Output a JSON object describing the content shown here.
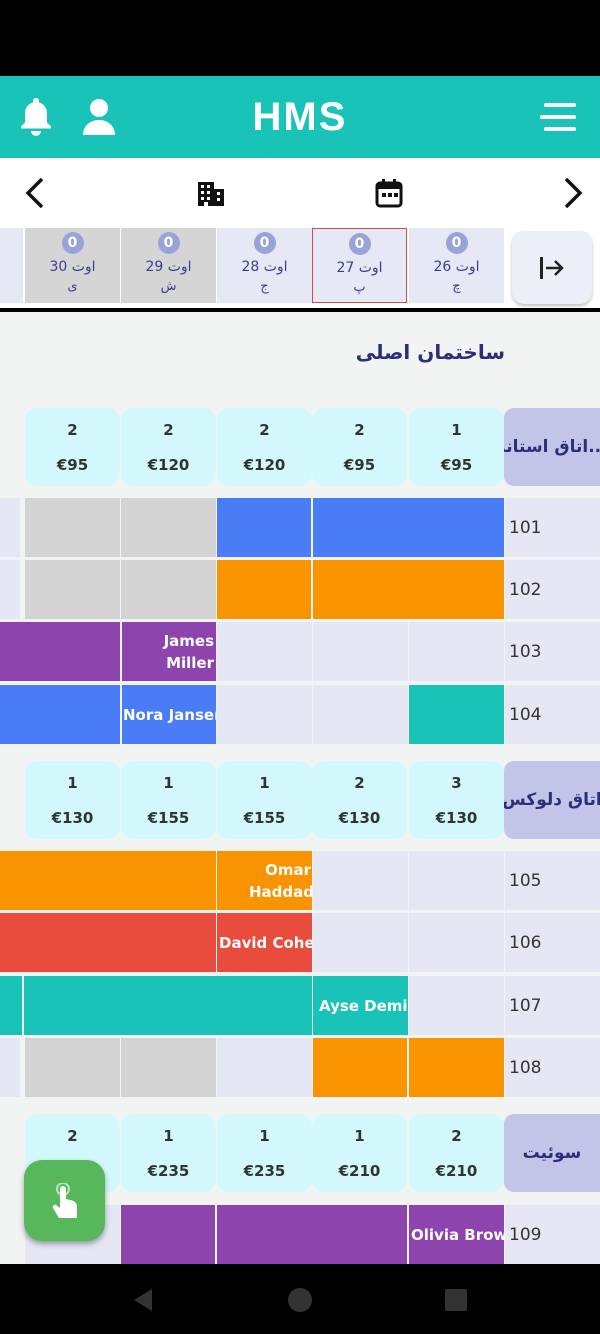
{
  "app": {
    "title": "HMS"
  },
  "nav": {
    "prev": "chevron-left-icon",
    "next": "chevron-right-icon",
    "building_icon": "building-icon",
    "calendar_icon": "calendar-icon"
  },
  "dates": [
    {
      "count": "0",
      "date": "26 اوت",
      "day": "چ"
    },
    {
      "count": "0",
      "date": "27 اوت",
      "day": "پ"
    },
    {
      "count": "0",
      "date": "28 اوت",
      "day": "ج"
    },
    {
      "count": "0",
      "date": "29 اوت",
      "day": "ش"
    },
    {
      "count": "0",
      "date": "30 اوت",
      "day": "ی"
    }
  ],
  "building": {
    "name": "ساختمان اصلی"
  },
  "room_types": [
    {
      "label": "اتاق استاند...",
      "cells": [
        {
          "count": "1",
          "price": "€95"
        },
        {
          "count": "2",
          "price": "€95"
        },
        {
          "count": "2",
          "price": "€120"
        },
        {
          "count": "2",
          "price": "€120"
        },
        {
          "count": "2",
          "price": "€95"
        }
      ]
    },
    {
      "label": "اتاق دلوکس",
      "cells": [
        {
          "count": "3",
          "price": "€130"
        },
        {
          "count": "2",
          "price": "€130"
        },
        {
          "count": "1",
          "price": "€155"
        },
        {
          "count": "1",
          "price": "€155"
        },
        {
          "count": "1",
          "price": "€130"
        }
      ]
    },
    {
      "label": "سوئیت",
      "cells": [
        {
          "count": "2",
          "price": "€210"
        },
        {
          "count": "1",
          "price": "€210"
        },
        {
          "count": "1",
          "price": "€235"
        },
        {
          "count": "1",
          "price": "€235"
        },
        {
          "count": "2",
          "price": ""
        }
      ]
    }
  ],
  "rooms": [
    "101",
    "102",
    "103",
    "104",
    "105",
    "106",
    "107",
    "108",
    "109"
  ],
  "guests": {
    "g103": "James Miller",
    "g104": "Nora Jansen",
    "g105": "Omar Haddad",
    "g106": "David Cohen",
    "g107": "Ayse Demir",
    "g109": "Olivia Brown"
  },
  "colors": {
    "teal": "#19c3b8",
    "blue": "#4a7cf5",
    "orange": "#f99400",
    "purple": "#8e44ad",
    "red": "#e74c3c",
    "green": "#56b85a"
  }
}
